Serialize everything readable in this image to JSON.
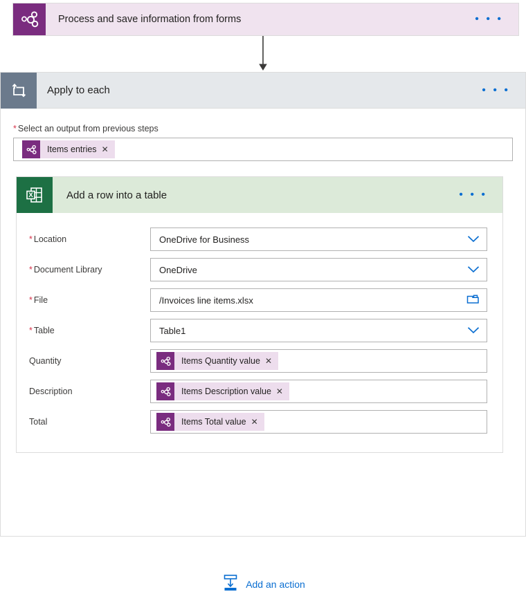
{
  "trigger": {
    "title": "Process and save information from forms",
    "icon": "forms-icon",
    "menu": "• • •",
    "bg_color": "#f0e3ef",
    "icon_color": "#7a2c7f"
  },
  "scope": {
    "title": "Apply to each",
    "icon": "loop-icon",
    "menu": "• • •",
    "header_color": "#e5e8eb",
    "icon_color": "#6b7a8c",
    "output_field": {
      "label": "Select an output from previous steps",
      "required": true,
      "required_mark": "*",
      "token": {
        "label": "Items entries",
        "remove": "✕",
        "icon": "forms-token-icon"
      }
    }
  },
  "action": {
    "title": "Add a row into a table",
    "icon": "excel-icon",
    "menu": "• • •",
    "header_color": "#dcead9",
    "icon_color": "#1d7044",
    "fields": [
      {
        "label": "Location",
        "required": true,
        "required_mark": "*",
        "type": "dropdown",
        "value": "OneDrive for Business",
        "icon": "chevron-down-icon"
      },
      {
        "label": "Document Library",
        "required": true,
        "required_mark": "*",
        "type": "dropdown",
        "value": "OneDrive",
        "icon": "chevron-down-icon"
      },
      {
        "label": "File",
        "required": true,
        "required_mark": "*",
        "type": "file-picker",
        "value": "/Invoices line items.xlsx",
        "icon": "folder-icon"
      },
      {
        "label": "Table",
        "required": true,
        "required_mark": "*",
        "type": "dropdown",
        "value": "Table1",
        "icon": "chevron-down-icon"
      },
      {
        "label": "Quantity",
        "required": false,
        "required_mark": "",
        "type": "token",
        "value": "Items Quantity value",
        "remove": "✕",
        "icon": "forms-token-icon"
      },
      {
        "label": "Description",
        "required": false,
        "required_mark": "",
        "type": "token",
        "value": "Items Description value",
        "remove": "✕",
        "icon": "forms-token-icon"
      },
      {
        "label": "Total",
        "required": false,
        "required_mark": "",
        "type": "token",
        "value": "Items Total value",
        "remove": "✕",
        "icon": "forms-token-icon"
      }
    ]
  },
  "footer": {
    "add_action_label": "Add an action",
    "icon": "insert-below-icon",
    "accent_color": "#0a6ed1"
  }
}
